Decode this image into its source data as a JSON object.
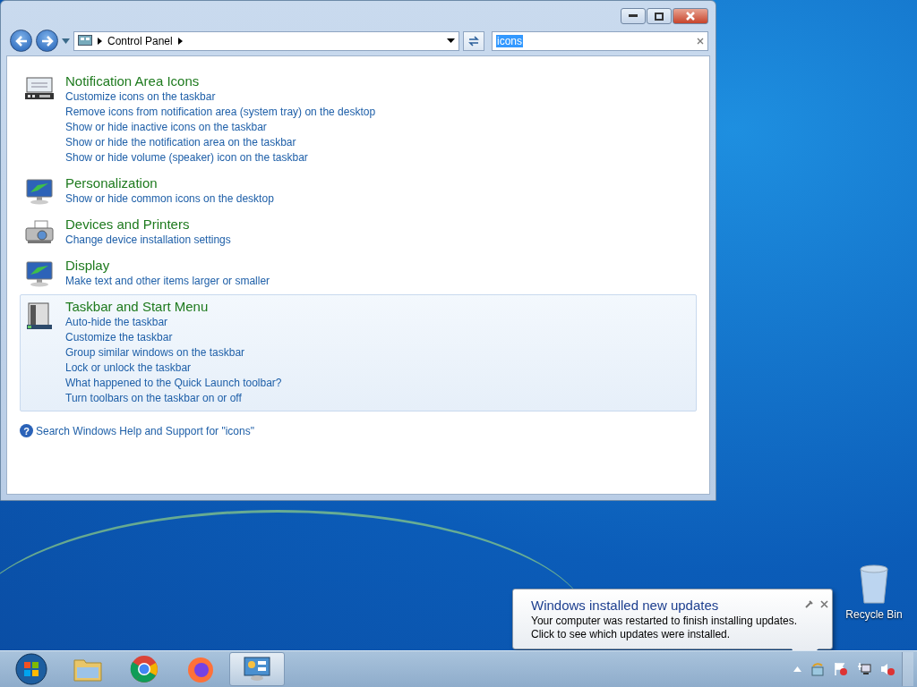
{
  "window": {
    "address": {
      "crumbs": [
        "Control Panel"
      ]
    },
    "search": {
      "value": "icons",
      "selected": true
    }
  },
  "sections": [
    {
      "title": "Notification Area Icons",
      "kind": "tray",
      "selected": false,
      "links": [
        "Customize icons on the taskbar",
        "Remove icons from notification area (system tray) on the desktop",
        "Show or hide inactive icons on the taskbar",
        "Show or hide the notification area on the taskbar",
        "Show or hide volume (speaker) icon on the taskbar"
      ]
    },
    {
      "title": "Personalization",
      "kind": "monitor",
      "selected": false,
      "links": [
        "Show or hide common icons on the desktop"
      ]
    },
    {
      "title": "Devices and Printers",
      "kind": "printer",
      "selected": false,
      "links": [
        "Change device installation settings"
      ]
    },
    {
      "title": "Display",
      "kind": "monitor",
      "selected": false,
      "links": [
        "Make text and other items larger or smaller"
      ]
    },
    {
      "title": "Taskbar and Start Menu",
      "kind": "taskbar",
      "selected": true,
      "links": [
        "Auto-hide the taskbar",
        "Customize the taskbar",
        "Group similar windows on the taskbar",
        "Lock or unlock the taskbar",
        "What happened to the Quick Launch toolbar?",
        "Turn toolbars on the taskbar on or off"
      ]
    }
  ],
  "help_icon": "?",
  "help_link": "Search Windows Help and Support for \"icons\"",
  "desktop_icons": [
    {
      "label": "Recycle Bin"
    }
  ],
  "balloon": {
    "title": "Windows installed new updates",
    "lines": [
      "Your computer was restarted to finish installing updates.",
      "Click to see which updates were installed."
    ]
  },
  "taskbar": {
    "items": [
      {
        "kind": "start",
        "active": false
      },
      {
        "kind": "folder",
        "active": false
      },
      {
        "kind": "chrome",
        "active": false
      },
      {
        "kind": "firefox",
        "active": false
      },
      {
        "kind": "controlpanel",
        "active": true
      }
    ],
    "tray": [
      {
        "kind": "arrow"
      },
      {
        "kind": "update"
      },
      {
        "kind": "flag"
      },
      {
        "kind": "network"
      },
      {
        "kind": "volume"
      }
    ]
  }
}
